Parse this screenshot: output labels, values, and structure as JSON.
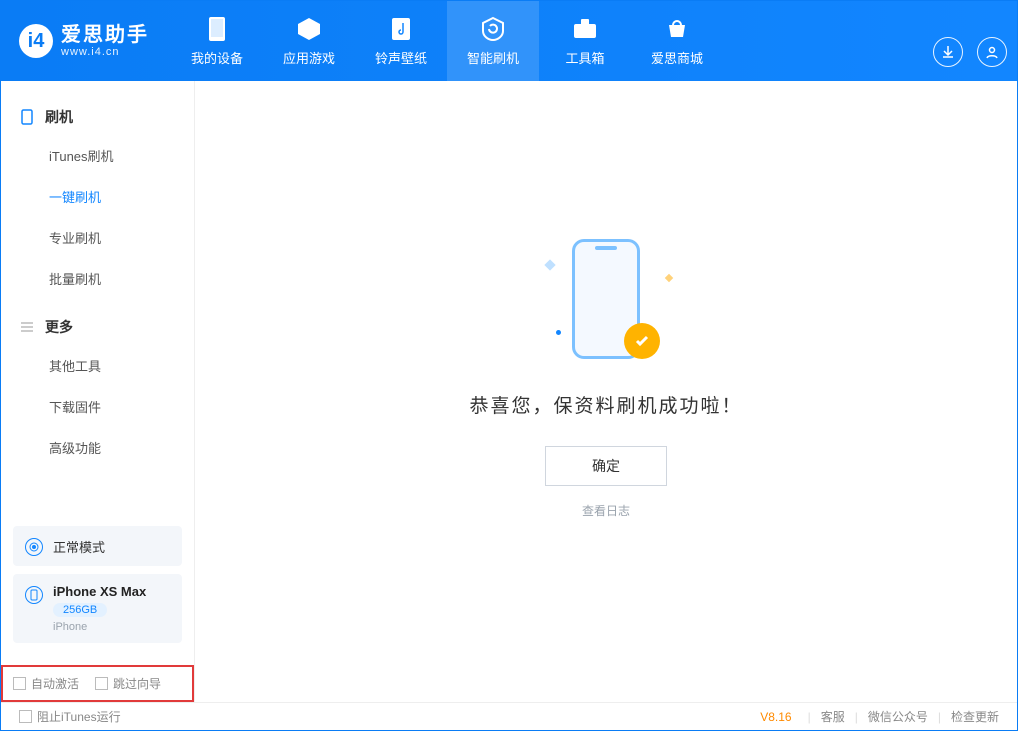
{
  "brand": {
    "name": "爱思助手",
    "url": "www.i4.cn"
  },
  "nav": {
    "items": [
      {
        "label": "我的设备",
        "icon": "device-icon"
      },
      {
        "label": "应用游戏",
        "icon": "cube-icon"
      },
      {
        "label": "铃声壁纸",
        "icon": "music-icon"
      },
      {
        "label": "智能刷机",
        "icon": "refresh-icon",
        "active": true
      },
      {
        "label": "工具箱",
        "icon": "toolbox-icon"
      },
      {
        "label": "爱思商城",
        "icon": "shop-icon"
      }
    ]
  },
  "sidebar": {
    "group_flash": {
      "title": "刷机",
      "items": [
        "iTunes刷机",
        "一键刷机",
        "专业刷机",
        "批量刷机"
      ],
      "active_index": 1
    },
    "group_more": {
      "title": "更多",
      "items": [
        "其他工具",
        "下载固件",
        "高级功能"
      ]
    }
  },
  "device_status": {
    "mode_label": "正常模式",
    "device_name": "iPhone XS Max",
    "storage": "256GB",
    "type": "iPhone"
  },
  "options": {
    "auto_activate": "自动激活",
    "skip_guide": "跳过向导"
  },
  "main": {
    "success_text": "恭喜您，保资料刷机成功啦！",
    "ok_button": "确定",
    "view_log": "查看日志"
  },
  "footer": {
    "block_itunes": "阻止iTunes运行",
    "version": "V8.16",
    "links": [
      "客服",
      "微信公众号",
      "检查更新"
    ]
  }
}
